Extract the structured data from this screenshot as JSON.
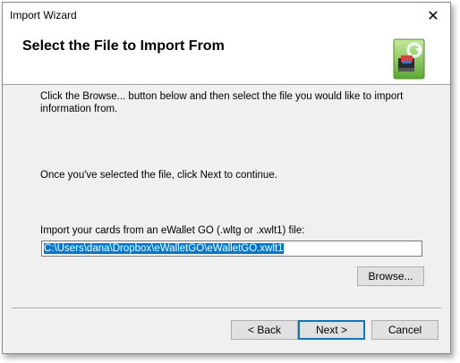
{
  "window": {
    "title": "Import Wizard",
    "close_glyph": "✕"
  },
  "header": {
    "title": "Select the File to Import From",
    "icon": "ewallet-import-icon"
  },
  "content": {
    "instruction": "Click the Browse... button below and then select the file you would like to import information from.",
    "next_hint": "Once you've selected the file, click Next to continue.",
    "file_label": "Import your cards from an eWallet GO (.wltg or .xwlt1) file:",
    "file_path": "C:\\Users\\dana\\Dropbox\\eWalletGO\\eWalletGO.xwlt1",
    "browse_label": "Browse..."
  },
  "footer": {
    "back_label": "< Back",
    "next_label": "Next >",
    "cancel_label": "Cancel"
  },
  "colors": {
    "selection": "#0078d7",
    "dialog_bg": "#f0f0f0"
  }
}
